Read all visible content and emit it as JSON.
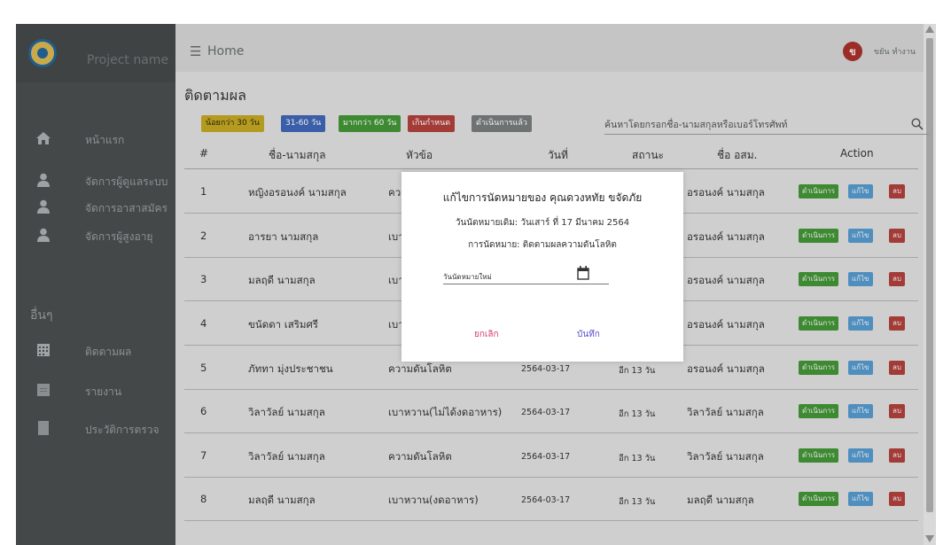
{
  "sidebar": {
    "project_name": "Project name",
    "items": [
      {
        "label": "หน้าแรก",
        "icon": "home-icon"
      },
      {
        "label": "จัดการผู้ดูแลระบบ",
        "icon": "user-icon"
      },
      {
        "label": "จัดการอาสาสมัคร",
        "icon": "user-icon"
      },
      {
        "label": "จัดการผู้สูงอายุ",
        "icon": "user-icon"
      }
    ],
    "section_label": "อื่นๆ",
    "other_items": [
      {
        "label": "ติดตามผล",
        "icon": "calendar-grid-icon"
      },
      {
        "label": "รายงาน",
        "icon": "document-icon"
      },
      {
        "label": "ประวัติการตรวจ",
        "icon": "file-icon"
      }
    ]
  },
  "topbar": {
    "home_label": "Home",
    "avatar_initial": "ข",
    "user_name": "ขยัน ทำงาน"
  },
  "page": {
    "title": "ติดตามผล",
    "filters": [
      {
        "label": "น้อยกว่า 30 วัน",
        "color": "#b49a1f"
      },
      {
        "label": "31-60 วัน",
        "color": "#3b5ea8"
      },
      {
        "label": "มากกว่า 60 วัน",
        "color": "#3e8a32"
      },
      {
        "label": "เกินกำหนด",
        "color": "#a33b37"
      },
      {
        "label": "ดำเนินการแล้ว",
        "color": "#6f7273"
      }
    ],
    "search_placeholder": "ค้นหาโดยกรอกชื่อ-นามสกุลหรือเบอร์โทรศัพท์"
  },
  "table": {
    "columns": [
      "#",
      "ชื่อ-นามสกุล",
      "หัวข้อ",
      "วันที่",
      "สถานะ",
      "ชื่อ อสม.",
      "Action"
    ],
    "rows": [
      {
        "num": "1",
        "name": "หญิงอรอนงค์ นามสกุล",
        "topic": "คว",
        "date": "",
        "status": "",
        "volunteer": "อรอนงค์ นามสกุล"
      },
      {
        "num": "2",
        "name": "อารยา นามสกุล",
        "topic": "เบา",
        "date": "",
        "status": "",
        "volunteer": "อรอนงค์ นามสกุล"
      },
      {
        "num": "3",
        "name": "มลฤดี นามสกุล",
        "topic": "เบา",
        "date": "",
        "status": "",
        "volunteer": "อรอนงค์ นามสกุล"
      },
      {
        "num": "4",
        "name": "ขนัดดา เสริมศรี",
        "topic": "เบา",
        "date": "",
        "status": "",
        "volunteer": "อรอนงค์ นามสกุล"
      },
      {
        "num": "5",
        "name": "ภัททา มุ่งประชาชน",
        "topic": "ความดันโลหิต",
        "date": "2564-03-17",
        "status": "อีก 13 วัน",
        "volunteer": "อรอนงค์ นามสกุล"
      },
      {
        "num": "6",
        "name": "วิลาวัลย์ นามสกุล",
        "topic": "เบาหวาน(ไม่ได้งดอาหาร)",
        "date": "2564-03-17",
        "status": "อีก 13 วัน",
        "volunteer": "วิลาวัลย์ นามสกุล"
      },
      {
        "num": "7",
        "name": "วิลาวัลย์ นามสกุล",
        "topic": "ความดันโลหิต",
        "date": "2564-03-17",
        "status": "อีก 13 วัน",
        "volunteer": "วิลาวัลย์ นามสกุล"
      },
      {
        "num": "8",
        "name": "มลฤดี นามสกุล",
        "topic": "เบาหวาน(งดอาหาร)",
        "date": "2564-03-17",
        "status": "อีก 13 วัน",
        "volunteer": "มลฤดี นามสกุล"
      }
    ],
    "actions": [
      {
        "label": "ดำเนินการ",
        "color": "#3e8a32"
      },
      {
        "label": "แก้ไข",
        "color": "#4f8fc0"
      },
      {
        "label": "ลบ",
        "color": "#a33b37"
      }
    ]
  },
  "modal": {
    "title": "แก้ไขการนัดหมายของ คุณดวงหทัย ขจัดภัย",
    "old_date": "วันนัดหมายเดิม: วันเสาร์ ที่ 17 มีนาคม 2564",
    "appointment": "การนัดหมาย: ติดตามผลความดันโลหิต",
    "new_date_placeholder": "วันนัดหมายใหม่",
    "cancel_label": "ยกเลิก",
    "save_label": "บันทึก",
    "cancel_color": "#d23a6e",
    "save_color": "#5a4ec9"
  }
}
